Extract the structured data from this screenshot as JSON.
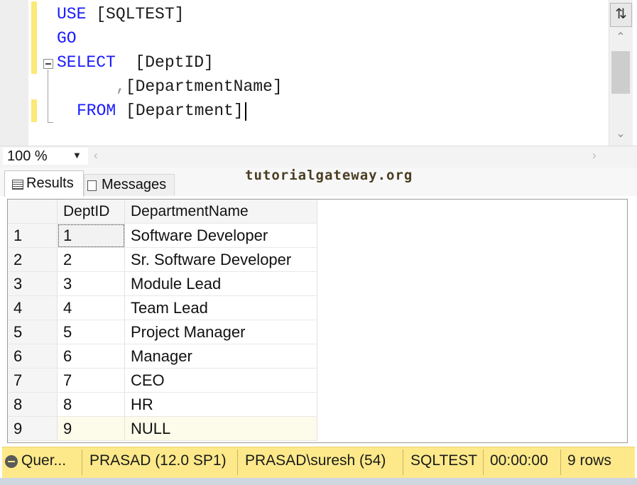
{
  "editor": {
    "lines": [
      {
        "keyword": "USE",
        "rest": " [SQLTEST]"
      },
      {
        "keyword": "GO",
        "rest": ""
      },
      {
        "keyword": "SELECT",
        "rest": "  [DeptID]"
      },
      {
        "comma": ",",
        "rest": "[DepartmentName]"
      },
      {
        "keyword": "FROM",
        "rest": " [Department]"
      }
    ]
  },
  "zoom": {
    "value": "100 %"
  },
  "tabs": [
    {
      "label": "Results",
      "active": true
    },
    {
      "label": "Messages",
      "active": false
    }
  ],
  "watermark": "tutorialgateway.org",
  "grid": {
    "columns": [
      "DeptID",
      "DepartmentName"
    ],
    "rows": [
      {
        "num": "1",
        "id": "1",
        "name": "Software Developer"
      },
      {
        "num": "2",
        "id": "2",
        "name": "Sr. Software Developer"
      },
      {
        "num": "3",
        "id": "3",
        "name": "Module Lead"
      },
      {
        "num": "4",
        "id": "4",
        "name": "Team Lead"
      },
      {
        "num": "5",
        "id": "5",
        "name": "Project Manager"
      },
      {
        "num": "6",
        "id": "6",
        "name": "Manager"
      },
      {
        "num": "7",
        "id": "7",
        "name": "CEO"
      },
      {
        "num": "8",
        "id": "8",
        "name": "HR"
      },
      {
        "num": "9",
        "id": "9",
        "name": "NULL"
      }
    ]
  },
  "statusbar": {
    "query_status": "Quer...",
    "server": "PRASAD (12.0 SP1)",
    "user": "PRASAD\\suresh (54)",
    "database": "SQLTEST",
    "elapsed": "00:00:00",
    "rows": "9 rows"
  },
  "colors": {
    "keyword": "#1a1aff",
    "statusbar_bg": "#fde98a",
    "change_marker": "#fbe978"
  }
}
